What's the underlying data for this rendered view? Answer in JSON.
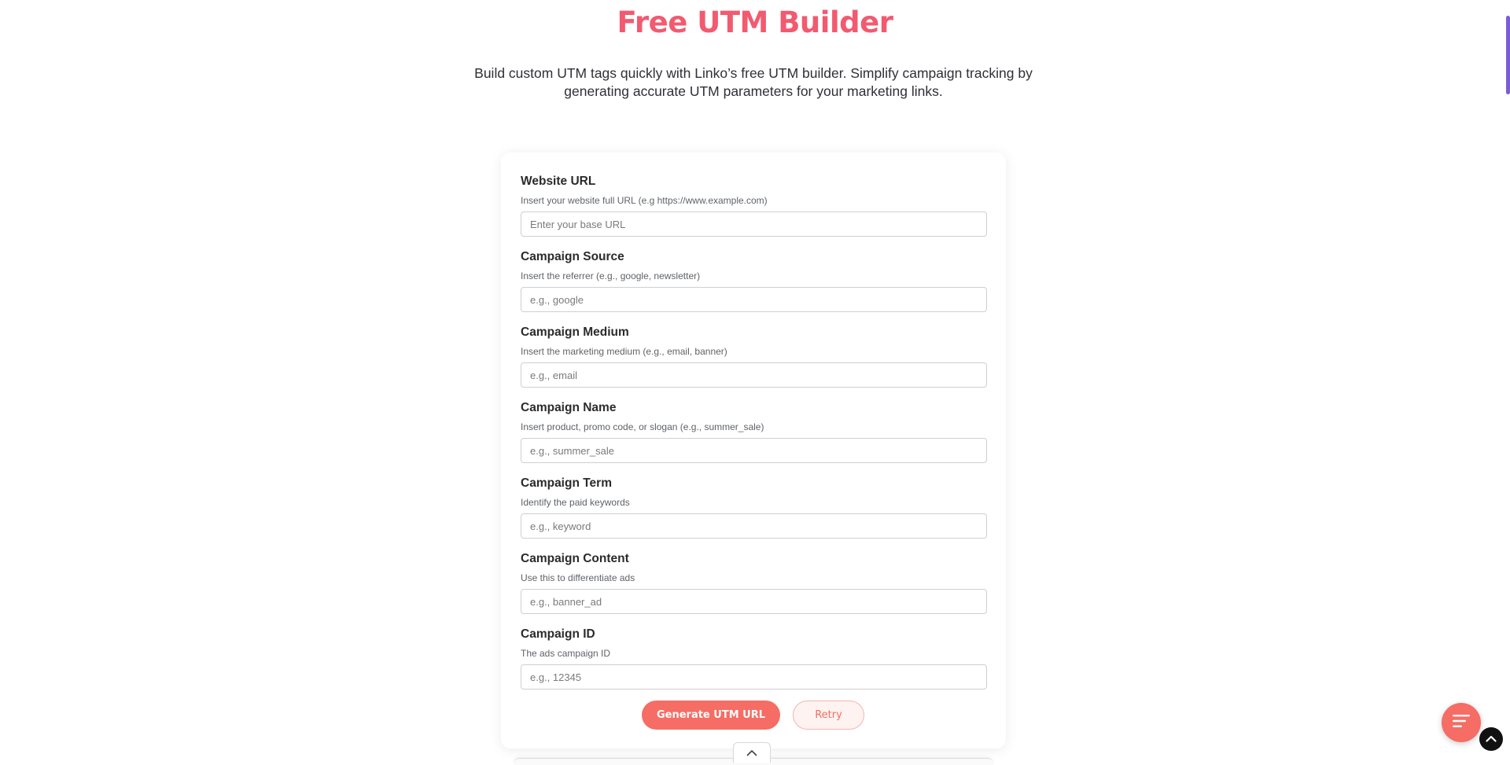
{
  "hero": {
    "title": "Free UTM Builder",
    "description": "Build custom UTM tags quickly with Linko’s free UTM builder. Simplify campaign tracking by generating accurate UTM parameters for your marketing links."
  },
  "form": {
    "fields": [
      {
        "label": "Website URL",
        "hint": "Insert your website full URL (e.g https://www.example.com)",
        "placeholder": "Enter your base URL",
        "value": ""
      },
      {
        "label": "Campaign Source",
        "hint": "Insert the referrer (e.g., google, newsletter)",
        "placeholder": "e.g., google",
        "value": ""
      },
      {
        "label": "Campaign Medium",
        "hint": "Insert the marketing medium (e.g., email, banner)",
        "placeholder": "e.g., email",
        "value": ""
      },
      {
        "label": "Campaign Name",
        "hint": "Insert product, promo code, or slogan (e.g., summer_sale)",
        "placeholder": "e.g., summer_sale",
        "value": ""
      },
      {
        "label": "Campaign Term",
        "hint": "Identify the paid keywords",
        "placeholder": "e.g., keyword",
        "value": ""
      },
      {
        "label": "Campaign Content",
        "hint": "Use this to differentiate ads",
        "placeholder": "e.g., banner_ad",
        "value": ""
      },
      {
        "label": "Campaign ID",
        "hint": "The ads campaign ID",
        "placeholder": "e.g., 12345",
        "value": ""
      }
    ],
    "generate_label": "Generate UTM URL",
    "retry_label": "Retry"
  },
  "icons": {
    "collapse": "chevron-up-icon",
    "chat": "menu-lines-icon",
    "back_to_top": "chevron-up-icon"
  },
  "colors": {
    "accent": "#f56d64",
    "title": "#f25a70",
    "scroll_indicator": "#7c5cd6"
  }
}
